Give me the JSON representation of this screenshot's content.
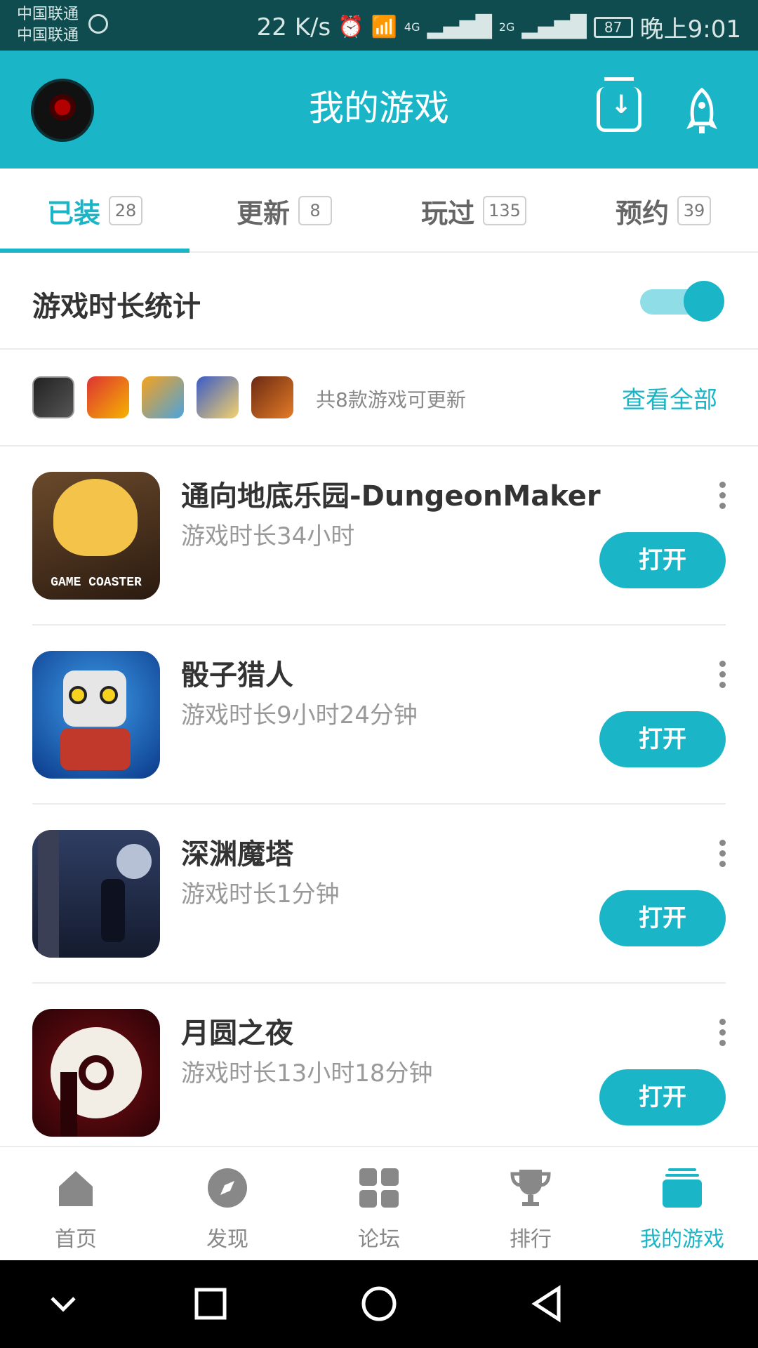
{
  "status_bar": {
    "carrier_1": "中国联通",
    "carrier_2": "中国联通",
    "speed": "22 K/s",
    "network_4g": "4G",
    "network_2g": "2G",
    "battery": "87",
    "time": "晚上9:01"
  },
  "app_bar": {
    "title": "我的游戏"
  },
  "tabs": [
    {
      "label": "已装",
      "count": "28"
    },
    {
      "label": "更新",
      "count": "8"
    },
    {
      "label": "玩过",
      "count": "135"
    },
    {
      "label": "预约",
      "count": "39"
    }
  ],
  "stats": {
    "label": "游戏时长统计",
    "toggle_on": true
  },
  "updates": {
    "summary": "共8款游戏可更新",
    "view_all": "查看全部"
  },
  "games": [
    {
      "name": "通向地底乐园-DungeonMaker",
      "duration": "游戏时长34小时",
      "button": "打开",
      "icon_text": "GAME COASTER"
    },
    {
      "name": "骰子猎人",
      "duration": "游戏时长9小时24分钟",
      "button": "打开"
    },
    {
      "name": "深渊魔塔",
      "duration": "游戏时长1分钟",
      "button": "打开"
    },
    {
      "name": "月圆之夜",
      "duration": "游戏时长13小时18分钟",
      "button": "打开"
    }
  ],
  "bottom_nav": [
    {
      "label": "首页",
      "icon": "home-icon"
    },
    {
      "label": "发现",
      "icon": "compass-icon"
    },
    {
      "label": "论坛",
      "icon": "grid-icon"
    },
    {
      "label": "排行",
      "icon": "trophy-icon"
    },
    {
      "label": "我的游戏",
      "icon": "games-stack-icon"
    }
  ],
  "colors": {
    "accent": "#1ab6c8",
    "status_bar": "#0f4c4f"
  }
}
